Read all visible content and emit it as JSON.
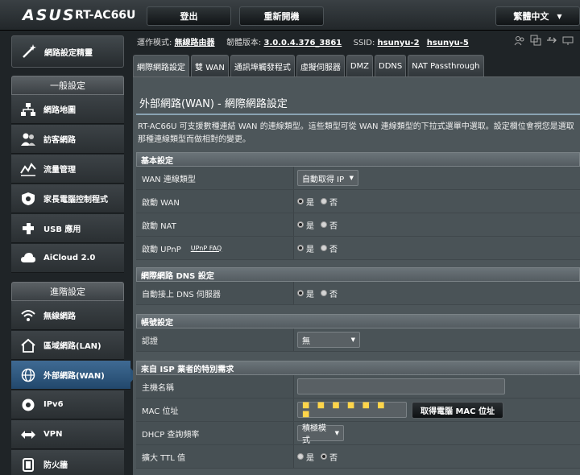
{
  "brand": "ASUS",
  "model": "RT-AC66U",
  "topbar": {
    "logout": "登出",
    "reboot": "重新開機",
    "language": "繁體中文"
  },
  "status": {
    "mode_label": "運作模式:",
    "mode_value": "無線路由器",
    "firmware_label": "韌體版本:",
    "firmware_value": "3.0.0.4.376_3861",
    "ssid_label": "SSID:",
    "ssid_1": "hsunyu-2",
    "ssid_2": "hsunyu-5"
  },
  "sidebar": {
    "qis_label": "網路設定精靈",
    "general_header": "一般設定",
    "general_items": [
      {
        "label": "網路地圖",
        "icon": "network-map-icon"
      },
      {
        "label": "訪客網路",
        "icon": "guest-network-icon"
      },
      {
        "label": "流量管理",
        "icon": "traffic-manager-icon"
      },
      {
        "label": "家長電腦控制程式",
        "icon": "parental-control-icon"
      },
      {
        "label": "USB 應用",
        "icon": "usb-icon"
      },
      {
        "label": "AiCloud 2.0",
        "icon": "cloud-icon"
      }
    ],
    "advanced_header": "進階設定",
    "advanced_items": [
      {
        "label": "無線網路",
        "icon": "wireless-icon"
      },
      {
        "label": "區域網路(LAN)",
        "icon": "home-icon"
      },
      {
        "label": "外部網路(WAN)",
        "icon": "globe-icon",
        "active": true
      },
      {
        "label": "IPv6",
        "icon": "ipv6-icon"
      },
      {
        "label": "VPN",
        "icon": "vpn-icon"
      },
      {
        "label": "防火牆",
        "icon": "firewall-icon"
      }
    ]
  },
  "tabs": [
    "網際網路設定",
    "雙 WAN",
    "通訊埠觸發程式",
    "虛擬伺服器",
    "DMZ",
    "DDNS",
    "NAT Passthrough"
  ],
  "page": {
    "title": "外部網路(WAN) - 網際網路設定",
    "description": "RT-AC66U 可支援數種連結 WAN 的連線類型。這些類型可從 WAN 連線類型的下拉式選單中選取。設定欄位會視您是選取那種連線類型而做相對的變更。"
  },
  "basic": {
    "header": "基本設定",
    "wan_type_label": "WAN 連線類型",
    "wan_type_value": "自動取得 IP",
    "enable_wan_label": "啟動 WAN",
    "enable_nat_label": "啟動 NAT",
    "enable_upnp_label": "啟動 UPnP",
    "upnp_faq": "UPnP FAQ",
    "yes": "是",
    "no": "否"
  },
  "dns": {
    "header": "網際網路 DNS 設定",
    "auto_dns_label": "自動接上 DNS 伺服器"
  },
  "account": {
    "header": "帳號設定",
    "auth_label": "認證",
    "auth_value": "無"
  },
  "isp": {
    "header": "來自 ISP 業者的特別需求",
    "hostname_label": "主機名稱",
    "hostname_value": "",
    "mac_label": "MAC 位址",
    "mac_button": "取得電腦 MAC 位址",
    "dhcp_label": "DHCP 查詢頻率",
    "dhcp_value": "積極模式",
    "ttl_label": "擴大 TTL 值"
  }
}
